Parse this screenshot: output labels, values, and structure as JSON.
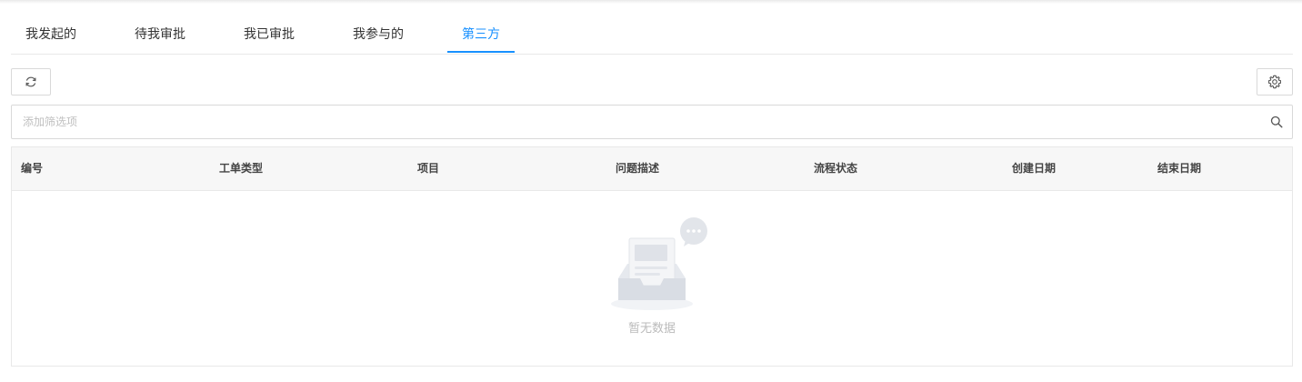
{
  "tabs": [
    {
      "label": "我发起的",
      "active": false
    },
    {
      "label": "待我审批",
      "active": false
    },
    {
      "label": "我已审批",
      "active": false
    },
    {
      "label": "我参与的",
      "active": false
    },
    {
      "label": "第三方",
      "active": true
    }
  ],
  "toolbar": {
    "refresh_icon": "refresh-icon",
    "settings_icon": "gear-icon"
  },
  "filter": {
    "placeholder": "添加筛选项",
    "value": "",
    "icon": "search-icon"
  },
  "table": {
    "columns": [
      "编号",
      "工单类型",
      "项目",
      "问题描述",
      "流程状态",
      "创建日期",
      "结束日期"
    ],
    "rows": [],
    "empty_text": "暂无数据"
  },
  "colors": {
    "accent": "#1890ff",
    "border": "#d9d9d9",
    "header_bg": "#f7f7f7",
    "empty_text": "#bbbbbb"
  }
}
